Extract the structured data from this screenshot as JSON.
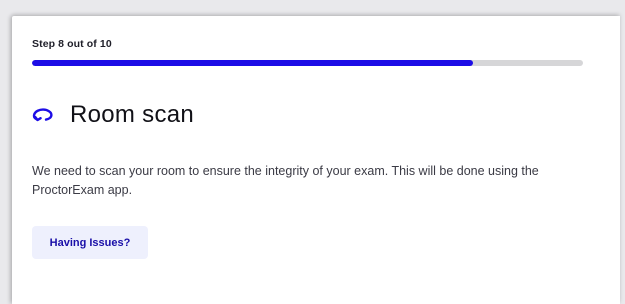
{
  "step": {
    "label": "Step 8 out of 10",
    "current": 8,
    "total": 10,
    "progress_fraction": 0.8
  },
  "header": {
    "icon": "rotate-icon",
    "title": "Room scan"
  },
  "main": {
    "description": "We need to scan your room to ensure the integrity of your exam. This will be done using the ProctorExam app."
  },
  "actions": {
    "issues_label": "Having Issues?"
  },
  "colors": {
    "accent": "#1d0de6",
    "track": "#d6d6d8",
    "button_bg": "#eef0fd",
    "button_text": "#1a0fa8"
  }
}
